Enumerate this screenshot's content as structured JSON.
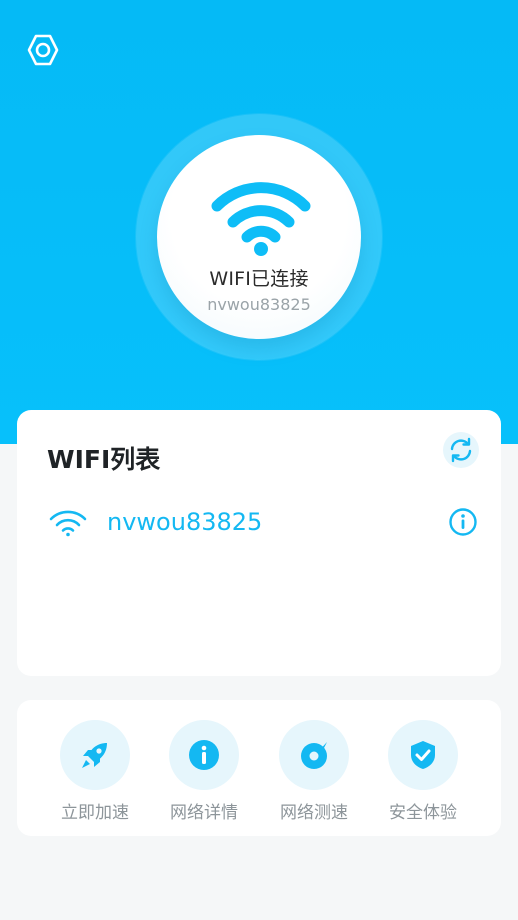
{
  "hero": {
    "status_text": "WIFI已连接",
    "connected_ssid": "nvwou83825",
    "bg_color": "#05baf6"
  },
  "wifi_list": {
    "title": "WIFI列表",
    "networks": [
      {
        "ssid": "nvwou83825",
        "icon": "wifi-icon",
        "action_icon": "info-icon"
      }
    ],
    "accent_color": "#14b8f2"
  },
  "tools": [
    {
      "label": "立即加速",
      "icon": "rocket-icon"
    },
    {
      "label": "网络详情",
      "icon": "info-icon"
    },
    {
      "label": "网络测速",
      "icon": "speedometer-icon"
    },
    {
      "label": "安全体验",
      "icon": "shield-check-icon"
    }
  ]
}
